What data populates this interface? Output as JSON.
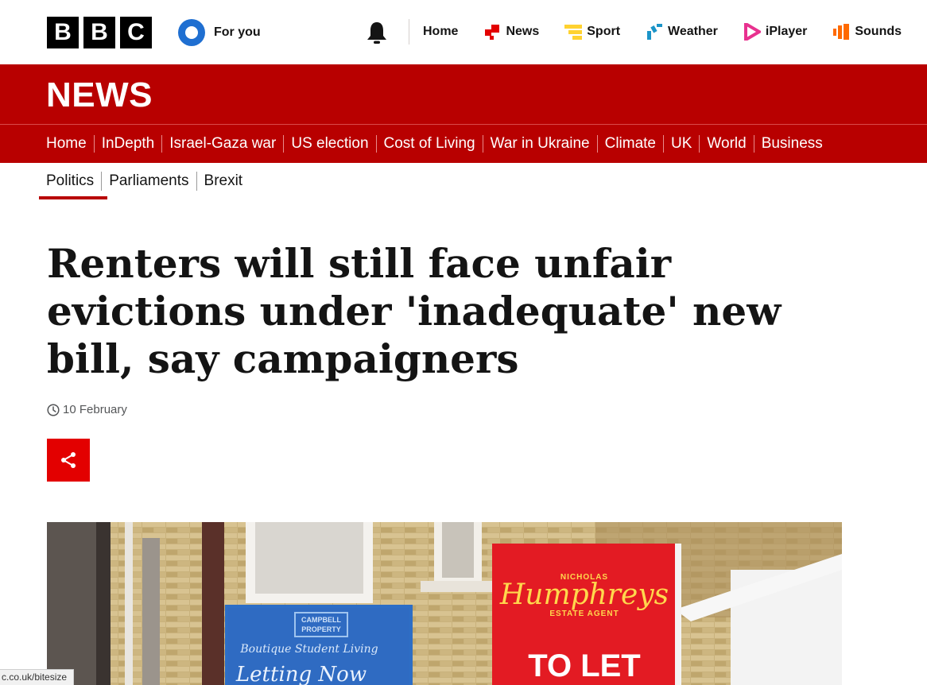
{
  "header": {
    "logo_letters": [
      "B",
      "B",
      "C"
    ],
    "for_you_label": "For you",
    "nav": [
      {
        "label": "Home",
        "icon": "none"
      },
      {
        "label": "News",
        "icon": "news-icon"
      },
      {
        "label": "Sport",
        "icon": "sport-icon"
      },
      {
        "label": "Weather",
        "icon": "weather-icon"
      },
      {
        "label": "iPlayer",
        "icon": "iplayer-icon"
      },
      {
        "label": "Sounds",
        "icon": "sounds-icon"
      }
    ]
  },
  "banner": {
    "title": "NEWS"
  },
  "subnav": [
    "Home",
    "InDepth",
    "Israel-Gaza war",
    "US election",
    "Cost of Living",
    "War in Ukraine",
    "Climate",
    "UK",
    "World",
    "Business"
  ],
  "section_nav": {
    "items": [
      "Politics",
      "Parliaments",
      "Brexit"
    ],
    "active": "Politics"
  },
  "article": {
    "headline": "Renters will still face unfair evictions under 'inadequate' new bill, say campaigners",
    "date": "10 February"
  },
  "hero_image": {
    "sign_blue": {
      "brand_top": "CAMPBELL",
      "brand_bottom": "PROPERTY",
      "tagline": "Boutique Student Living",
      "script": "Letting Now"
    },
    "sign_red": {
      "small_top": "NICHOLAS",
      "brand": "Humphreys",
      "small_bottom": "ESTATE AGENT",
      "big": "TO LET"
    }
  },
  "status_bar": {
    "url": "c.co.uk/bitesize"
  },
  "colors": {
    "bbc_red": "#b80000",
    "share_red": "#e30000",
    "text": "#141414"
  }
}
